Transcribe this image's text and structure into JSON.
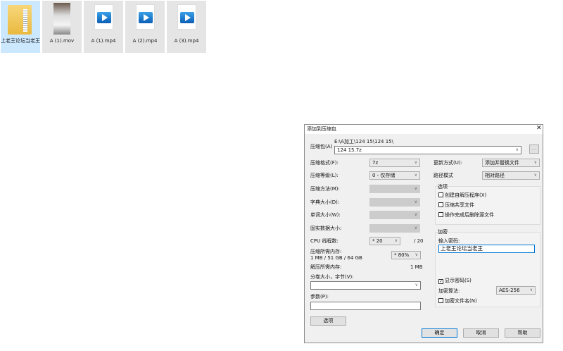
{
  "files": [
    {
      "name": "上老王论坛当老王",
      "type": "folder"
    },
    {
      "name": "A (1).mov",
      "type": "video-thumb"
    },
    {
      "name": "A (1).mp4",
      "type": "mp4"
    },
    {
      "name": "A (2).mp4",
      "type": "mp4"
    },
    {
      "name": "A (3).mp4",
      "type": "mp4"
    }
  ],
  "dialog": {
    "title": "添加到压缩包",
    "close": "✕",
    "archive_label": "压缩包(A)",
    "archive_path": "E:\\A加工\\124 15\\124 15\\",
    "archive_name": "124 15.7z",
    "browse": "...",
    "format_label": "压缩格式(F):",
    "format": "7z",
    "level_label": "压缩等级(L):",
    "level": "0 - 仅存储",
    "method_label": "压缩方法(M):",
    "dict_label": "字典大小(D):",
    "word_label": "单词大小(W):",
    "solid_label": "固实数据大小:",
    "cpu_label": "CPU 线程数:",
    "cpu": "* 20",
    "cpu_max": "/ 20",
    "mem_label": "压缩所需内存:",
    "mem_value": "1 MB / 51 GB / 64 GB",
    "mem_pct": "* 80%",
    "dmem_label": "解压所需内存:",
    "dmem_value": "1 MB",
    "split_label": "分卷大小，字节(V):",
    "split": "",
    "params_label": "参数(P):",
    "params": "",
    "options_btn": "选项",
    "update_label": "更新方式(U):",
    "update": "添加并替换文件",
    "path_label": "路径模式",
    "path": "相对路径",
    "options_group": "选项",
    "opt_sfx": "创建自解压程序(X)",
    "opt_shared": "压缩共享文件",
    "opt_delete": "操作完成后删除源文件",
    "enc_group": "加密",
    "pwd_label": "输入密码:",
    "pwd": "上老王论坛当老王",
    "show_pwd": "显示密码(S)",
    "alg_label": "加密算法:",
    "alg": "AES-256",
    "enc_names": "加密文件名(N)",
    "ok": "确定",
    "cancel": "取消",
    "help": "帮助"
  }
}
